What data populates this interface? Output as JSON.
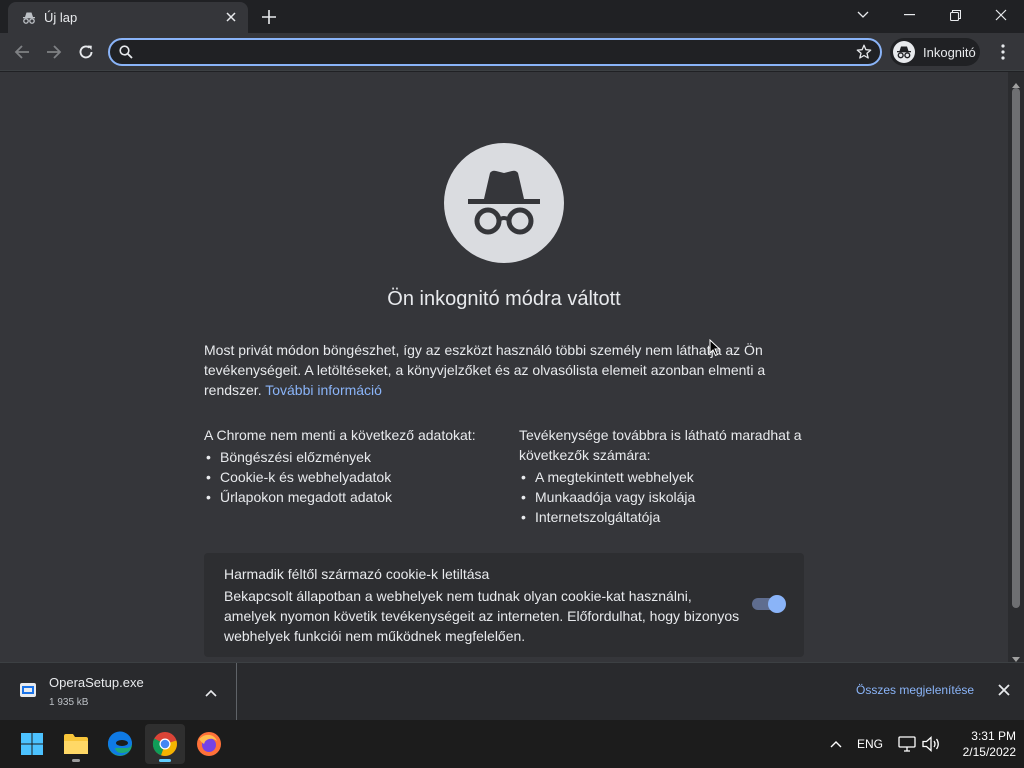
{
  "tab": {
    "title": "Új lap",
    "icon": "incognito-icon"
  },
  "window_controls": [
    "tab-search-icon",
    "minimize-icon",
    "restore-icon",
    "close-icon"
  ],
  "toolbar": {
    "omnibox_value": "",
    "profile_label": "Inkognitó"
  },
  "page": {
    "headline": "Ön inkognitó módra váltott",
    "intro": "Most privát módon böngészhet, így az eszközt használó többi személy nem láthatja az Ön tevékenységeit. A letöltéseket, a könyvjelzőket és az olvasólista elemeit azonban elmenti a rendszer.",
    "learn_more": "További információ",
    "left_heading": "A Chrome nem menti a következő adatokat:",
    "left_items": [
      "Böngészési előzmények",
      "Cookie-k és webhelyadatok",
      "Űrlapokon megadott adatok"
    ],
    "right_heading": "Tevékenysége továbbra is látható maradhat a következők számára:",
    "right_items": [
      "A megtekintett webhelyek",
      "Munkaadója vagy iskolája",
      "Internetszolgáltatója"
    ],
    "cookie_title": "Harmadik féltől származó cookie-k letiltása",
    "cookie_desc": "Bekapcsolt állapotban a webhelyek nem tudnak olyan cookie-kat használni, amelyek nyomon követik tevékenységeit az interneten. Előfordulhat, hogy bizonyos webhelyek funkciói nem működnek megfelelően.",
    "cookie_toggle_on": true
  },
  "download": {
    "file_name": "OperaSetup.exe",
    "file_size": "1 935 kB",
    "show_all": "Összes megjelenítése"
  },
  "taskbar": {
    "apps": [
      "windows-start-icon",
      "file-explorer-icon",
      "edge-icon",
      "chrome-icon",
      "firefox-icon"
    ],
    "active_app": "chrome-icon",
    "language": "ENG",
    "time": "3:31 PM",
    "date": "2/15/2022"
  },
  "colors": {
    "accent": "#8ab4f8",
    "background": "#35363a",
    "frame": "#202124"
  }
}
